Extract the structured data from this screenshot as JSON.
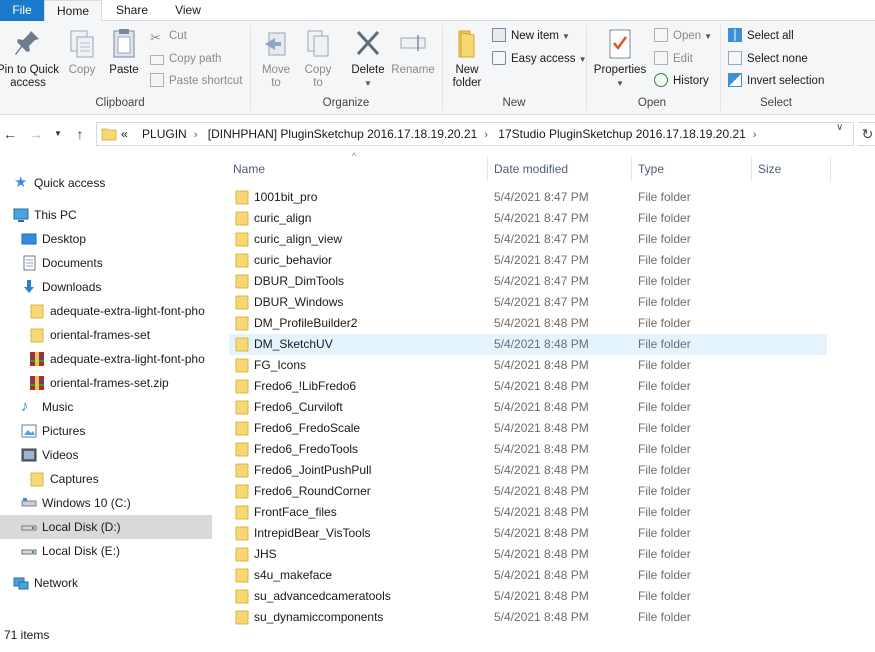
{
  "tabs": {
    "file": "File",
    "home": "Home",
    "share": "Share",
    "view": "View"
  },
  "ribbon": {
    "clipboard": {
      "label": "Clipboard",
      "pin": "Pin to Quick\naccess",
      "copy": "Copy",
      "paste": "Paste",
      "cut": "Cut",
      "copy_path": "Copy path",
      "paste_shortcut": "Paste shortcut"
    },
    "organize": {
      "label": "Organize",
      "move_to": "Move\nto",
      "copy_to": "Copy\nto",
      "delete": "Delete",
      "rename": "Rename"
    },
    "new": {
      "label": "New",
      "new_folder": "New\nfolder",
      "new_item": "New item",
      "easy_access": "Easy access"
    },
    "open": {
      "label": "Open",
      "properties": "Properties",
      "open": "Open",
      "edit": "Edit",
      "history": "History"
    },
    "select": {
      "label": "Select",
      "select_all": "Select all",
      "select_none": "Select none",
      "invert_selection": "Invert selection"
    }
  },
  "address": {
    "overflow": "«",
    "crumbs": [
      "PLUGIN",
      "[DINHPHAN] PluginSketchup 2016.17.18.19.20.21",
      "17Studio PluginSketchup 2016.17.18.19.20.21"
    ]
  },
  "nav": {
    "items": [
      {
        "label": "Quick access",
        "icon": "star-icon"
      },
      {
        "label": "This PC",
        "icon": "computer-icon"
      },
      {
        "label": "Desktop",
        "icon": "desktop-icon"
      },
      {
        "label": "Documents",
        "icon": "documents-icon"
      },
      {
        "label": "Downloads",
        "icon": "download-arrow-icon"
      },
      {
        "label": "adequate-extra-light-font-pho",
        "icon": "folder-icon"
      },
      {
        "label": "oriental-frames-set",
        "icon": "folder-icon"
      },
      {
        "label": "adequate-extra-light-font-pho",
        "icon": "archive-icon"
      },
      {
        "label": "oriental-frames-set.zip",
        "icon": "archive-icon"
      },
      {
        "label": "Music",
        "icon": "music-icon"
      },
      {
        "label": "Pictures",
        "icon": "pictures-icon"
      },
      {
        "label": "Videos",
        "icon": "videos-icon"
      },
      {
        "label": "Captures",
        "icon": "folder-icon"
      },
      {
        "label": "Windows 10 (C:)",
        "icon": "drive-icon"
      },
      {
        "label": "Local Disk (D:)",
        "icon": "drive-icon"
      },
      {
        "label": "Local Disk (E:)",
        "icon": "drive-icon"
      },
      {
        "label": "Network",
        "icon": "network-icon"
      }
    ]
  },
  "columns": {
    "name": "Name",
    "date": "Date modified",
    "type": "Type",
    "size": "Size"
  },
  "files": [
    {
      "name": "1001bit_pro",
      "date": "5/4/2021 8:47 PM",
      "type": "File folder"
    },
    {
      "name": "curic_align",
      "date": "5/4/2021 8:47 PM",
      "type": "File folder"
    },
    {
      "name": "curic_align_view",
      "date": "5/4/2021 8:47 PM",
      "type": "File folder"
    },
    {
      "name": "curic_behavior",
      "date": "5/4/2021 8:47 PM",
      "type": "File folder"
    },
    {
      "name": "DBUR_DimTools",
      "date": "5/4/2021 8:47 PM",
      "type": "File folder"
    },
    {
      "name": "DBUR_Windows",
      "date": "5/4/2021 8:47 PM",
      "type": "File folder"
    },
    {
      "name": "DM_ProfileBuilder2",
      "date": "5/4/2021 8:48 PM",
      "type": "File folder"
    },
    {
      "name": "DM_SketchUV",
      "date": "5/4/2021 8:48 PM",
      "type": "File folder"
    },
    {
      "name": "FG_Icons",
      "date": "5/4/2021 8:48 PM",
      "type": "File folder"
    },
    {
      "name": "Fredo6_!LibFredo6",
      "date": "5/4/2021 8:48 PM",
      "type": "File folder"
    },
    {
      "name": "Fredo6_Curviloft",
      "date": "5/4/2021 8:48 PM",
      "type": "File folder"
    },
    {
      "name": "Fredo6_FredoScale",
      "date": "5/4/2021 8:48 PM",
      "type": "File folder"
    },
    {
      "name": "Fredo6_FredoTools",
      "date": "5/4/2021 8:48 PM",
      "type": "File folder"
    },
    {
      "name": "Fredo6_JointPushPull",
      "date": "5/4/2021 8:48 PM",
      "type": "File folder"
    },
    {
      "name": "Fredo6_RoundCorner",
      "date": "5/4/2021 8:48 PM",
      "type": "File folder"
    },
    {
      "name": "FrontFace_files",
      "date": "5/4/2021 8:48 PM",
      "type": "File folder"
    },
    {
      "name": "IntrepidBear_VisTools",
      "date": "5/4/2021 8:48 PM",
      "type": "File folder"
    },
    {
      "name": "JHS",
      "date": "5/4/2021 8:48 PM",
      "type": "File folder"
    },
    {
      "name": "s4u_makeface",
      "date": "5/4/2021 8:48 PM",
      "type": "File folder"
    },
    {
      "name": "su_advancedcameratools",
      "date": "5/4/2021 8:48 PM",
      "type": "File folder"
    },
    {
      "name": "su_dynamiccomponents",
      "date": "5/4/2021 8:48 PM",
      "type": "File folder"
    }
  ],
  "status": {
    "items": "71 items"
  },
  "colors": {
    "accent": "#1979ca",
    "folder": "#f8d775",
    "hover": "#e5f3ff",
    "selected": "#d9d9d9"
  }
}
